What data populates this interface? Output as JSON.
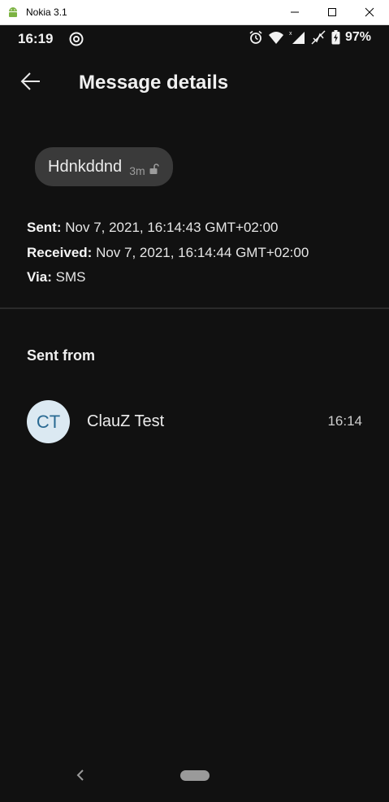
{
  "window": {
    "title": "Nokia 3.1",
    "icons": [
      "android-icon",
      "minimize-icon",
      "maximize-icon",
      "close-icon"
    ]
  },
  "status_bar": {
    "time": "16:19",
    "battery": "97%",
    "icons": [
      "at-sign-icon",
      "alarm-icon",
      "wifi-icon",
      "signal-icon",
      "no-signal-icon",
      "battery-charging-icon"
    ]
  },
  "app_bar": {
    "title": "Message details",
    "back_icon": "arrow-left-icon"
  },
  "message": {
    "text": "Hdnkddnd",
    "age": "3m",
    "lock_icon": "unlocked-icon"
  },
  "details": {
    "sent_label": "Sent:",
    "sent_value": "Nov 7, 2021, 16:14:43 GMT+02:00",
    "received_label": "Received:",
    "received_value": "Nov 7, 2021, 16:14:44 GMT+02:00",
    "via_label": "Via:",
    "via_value": "SMS"
  },
  "sent_from": {
    "heading": "Sent from",
    "contact": {
      "initials": "CT",
      "name": "ClauZ Test",
      "time": "16:14"
    }
  },
  "colors": {
    "background": "#111111",
    "bubble": "#3a3a3a",
    "avatar_bg": "#dbe9f2",
    "avatar_text": "#2a6a93"
  }
}
